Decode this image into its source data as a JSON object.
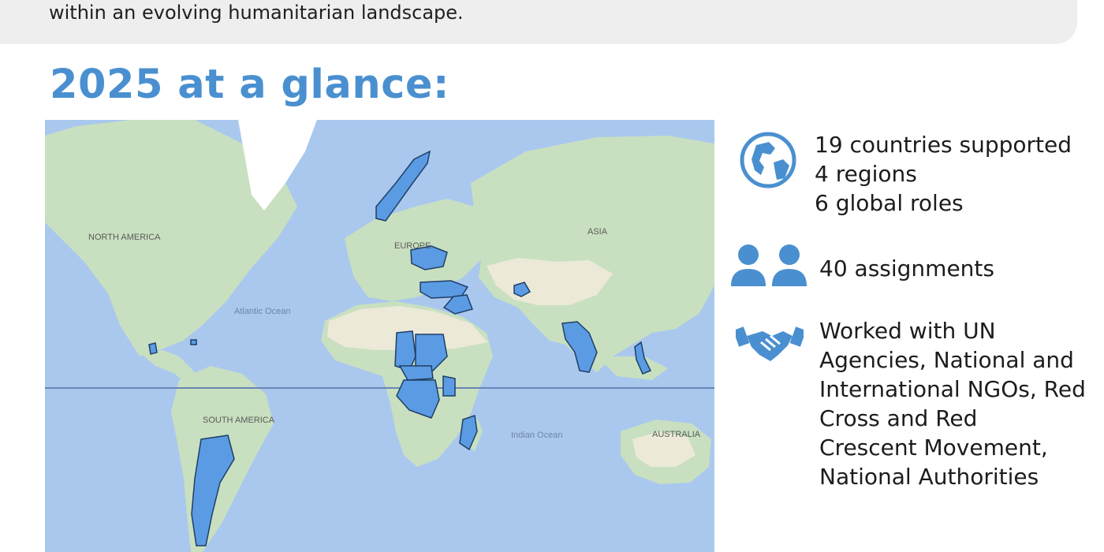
{
  "intro": {
    "text": "within an evolving humanitarian landscape."
  },
  "page": {
    "title": "2025 at a glance:"
  },
  "colors": {
    "accent": "#4a90d0",
    "ocean": "#aac8ee",
    "land": "#c8e0c0",
    "desert": "#ece9d8",
    "ice": "#ffffff",
    "highlight": "#5b9be3",
    "highlight_border": "#1f3f66",
    "banner": "#eeeeee"
  },
  "map": {
    "labels": {
      "north_america": "NORTH AMERICA",
      "south_america": "SOUTH AMERICA",
      "europe": "EUROPE",
      "asia": "ASIA",
      "australia": "AUSTRALIA",
      "atlantic": "Atlantic Ocean",
      "indian": "Indian Ocean"
    }
  },
  "stats": {
    "countries": {
      "icon": "globe-icon",
      "lines": [
        "19 countries supported",
        " 4 regions",
        " 6 global roles"
      ]
    },
    "assignments": {
      "icon": "people-icon",
      "lines": [
        "40 assignments"
      ]
    },
    "partners": {
      "icon": "handshake-icon",
      "lines": [
        "Worked with UN",
        "Agencies, National and",
        "International NGOs, Red",
        "Cross and Red",
        "Crescent Movement,",
        "National Authorities"
      ]
    }
  }
}
